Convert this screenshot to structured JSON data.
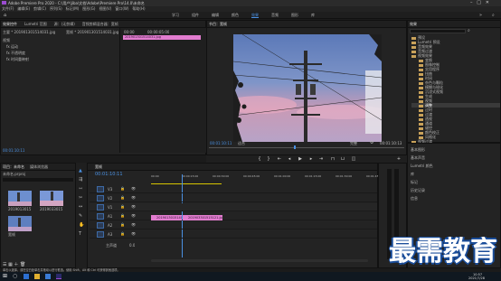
{
  "title_bar": {
    "app_title": "Adobe Premiere Pro 2020 - C:\\用户\\Jiba\\文档\\Adobe\\Premiere Pro\\14.0\\未命名"
  },
  "menu": [
    "文件(F)",
    "编辑(E)",
    "剪辑(C)",
    "序列(S)",
    "标记(M)",
    "图形(G)",
    "视图(V)",
    "窗口(W)",
    "帮助(H)"
  ],
  "workspaces": {
    "items": [
      "学习",
      "组件",
      "编辑",
      "颜色",
      "效果",
      "音频",
      "图形",
      "库"
    ],
    "active": "效果"
  },
  "source_panel": {
    "tabs": [
      "效果控件",
      "Lumetri 范围",
      "源：(无剪辑)",
      "音频剪辑混合器：宽帧"
    ],
    "master": "主要 * 201901301514031.jpg",
    "clip": "宽帧 * 201901301514031.jpg",
    "rows": [
      "视频",
      "fx 运动",
      "fx 不透明度",
      "fx 时间重映射"
    ],
    "time_a": "00:00",
    "time_b": "00:00:05:00",
    "clip_label": "201901301514031.jpg",
    "tc": "00:01:10:11"
  },
  "program": {
    "title": "节目：宽帧",
    "timecode": "00:01:10:11",
    "fit": "适合",
    "quality": "完整",
    "duration": "00:01:10:13"
  },
  "effects": {
    "title": "效果",
    "items": [
      "预设",
      "Lumetri 预设",
      "音频效果",
      "音频过渡",
      "视频效果",
      "变换",
      "图像控制",
      "实用程序",
      "扭曲",
      "时间",
      "杂色与颗粒",
      "模糊与锐化",
      "沉浸式视频",
      "生成",
      "视频",
      "调整",
      "过时",
      "过渡",
      "透视",
      "通道",
      "键控",
      "颜色校正",
      "风格化",
      "视频过渡"
    ],
    "selected": "调整"
  },
  "right_panel": [
    "基本图形",
    "基本声音",
    "Lumetri 颜色",
    "库",
    "标记",
    "历史记录",
    "信息"
  ],
  "project": {
    "tabs": [
      "项目：未命名",
      "媒体浏览器"
    ],
    "path": "未命名.prproj",
    "items": [
      {
        "name": "201901301514031.jpg",
        "dur": "5:00"
      },
      {
        "name": "201903301515121.jpg",
        "dur": "5:00"
      },
      {
        "name": "宽帧",
        "dur": "1:10:13"
      }
    ]
  },
  "timeline": {
    "title": "宽帧",
    "timecode": "00:01:10:11",
    "ruler": [
      "00:00",
      "00:00:15:00",
      "00:00:30:00",
      "00:00:45:00",
      "00:01:00:00",
      "00:01:15:00",
      "00:01:30:00",
      "00:01:45:00"
    ],
    "tracks": [
      "V3",
      "V2",
      "V1",
      "A1",
      "A2",
      "A3"
    ],
    "clips": [
      "201901301514031.jpg",
      "201903301515121.jpg"
    ],
    "master": "主声道",
    "master_value": "0.0"
  },
  "status_text": "单击以选择，或在空白处单击并拖动以进行框选。使用 Shift、Alt 和 Ctrl 可获得其他选项。",
  "watermark": "最需教育",
  "taskbar": {
    "time": "10:57",
    "date": "2021/7/28"
  }
}
